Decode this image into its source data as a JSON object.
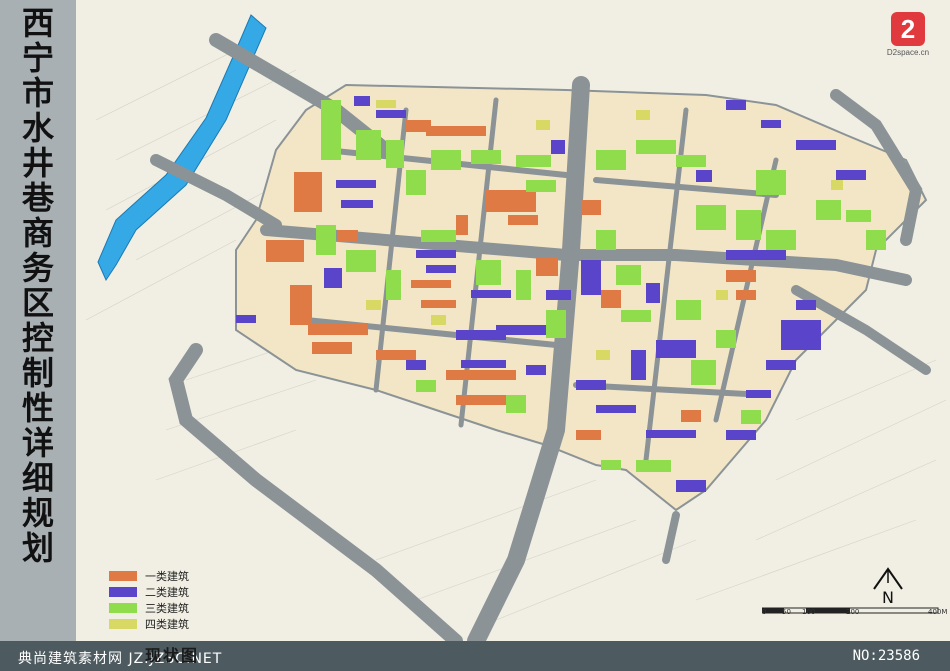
{
  "title_vertical": [
    "西",
    "宁",
    "市",
    "水",
    "井",
    "巷",
    "商",
    "务",
    "区",
    "控",
    "制",
    "性",
    "详",
    "细",
    "规",
    "划"
  ],
  "logo": {
    "mark": "2",
    "site": "D2space.cn"
  },
  "legend": [
    {
      "label": "一类建筑",
      "color": "#e07a45"
    },
    {
      "label": "二类建筑",
      "color": "#5a44c9"
    },
    {
      "label": "三类建筑",
      "color": "#8fdc4d"
    },
    {
      "label": "四类建筑",
      "color": "#d8d865"
    }
  ],
  "scalebar": {
    "ticks": [
      "0",
      "50",
      "100",
      "200",
      "400M"
    ]
  },
  "north": {
    "label": "N"
  },
  "footer": {
    "left": "典尚建筑素材网 JZ.JZSC.NET",
    "map_title": "现状图",
    "right": "NO:23586"
  },
  "colors": {
    "road": "#8b9396",
    "river": "#35a8e6",
    "block_fill": "#f3e6c7"
  }
}
